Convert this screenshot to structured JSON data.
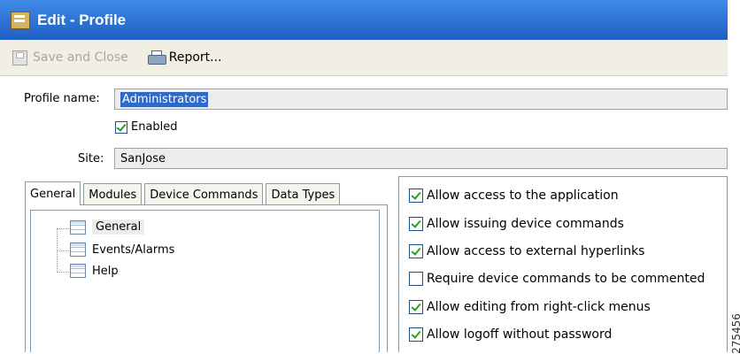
{
  "window": {
    "title": "Edit - Profile"
  },
  "toolbar": {
    "save_close_label": "Save and Close",
    "report_label": "Report..."
  },
  "form": {
    "profile_name_label": "Profile name:",
    "profile_name_value": "Administrators",
    "enabled_label": "Enabled",
    "enabled_checked": true,
    "site_label": "Site:",
    "site_value": "SanJose"
  },
  "tabs": [
    {
      "label": "General",
      "active": true
    },
    {
      "label": "Modules",
      "active": false
    },
    {
      "label": "Device Commands",
      "active": false
    },
    {
      "label": "Data Types",
      "active": false
    }
  ],
  "tree": {
    "items": [
      {
        "label": "General",
        "selected": true
      },
      {
        "label": "Events/Alarms",
        "selected": false
      },
      {
        "label": "Help",
        "selected": false
      }
    ]
  },
  "permissions": [
    {
      "label": "Allow access to the application",
      "checked": true
    },
    {
      "label": "Allow issuing device commands",
      "checked": true
    },
    {
      "label": "Allow access to external hyperlinks",
      "checked": true
    },
    {
      "label": "Require device commands to be commented",
      "checked": false
    },
    {
      "label": "Allow editing from right-click menus",
      "checked": true
    },
    {
      "label": "Allow logoff without password",
      "checked": true
    }
  ],
  "figure_id": "275456",
  "icons": {
    "title": "profile-window-icon",
    "save": "floppy-disk-icon",
    "report": "printer-icon",
    "tree_item": "table-icon"
  },
  "colors": {
    "titlebar": "#2a6fd6",
    "check_mark": "#21a121",
    "selection": "#316ac5"
  }
}
